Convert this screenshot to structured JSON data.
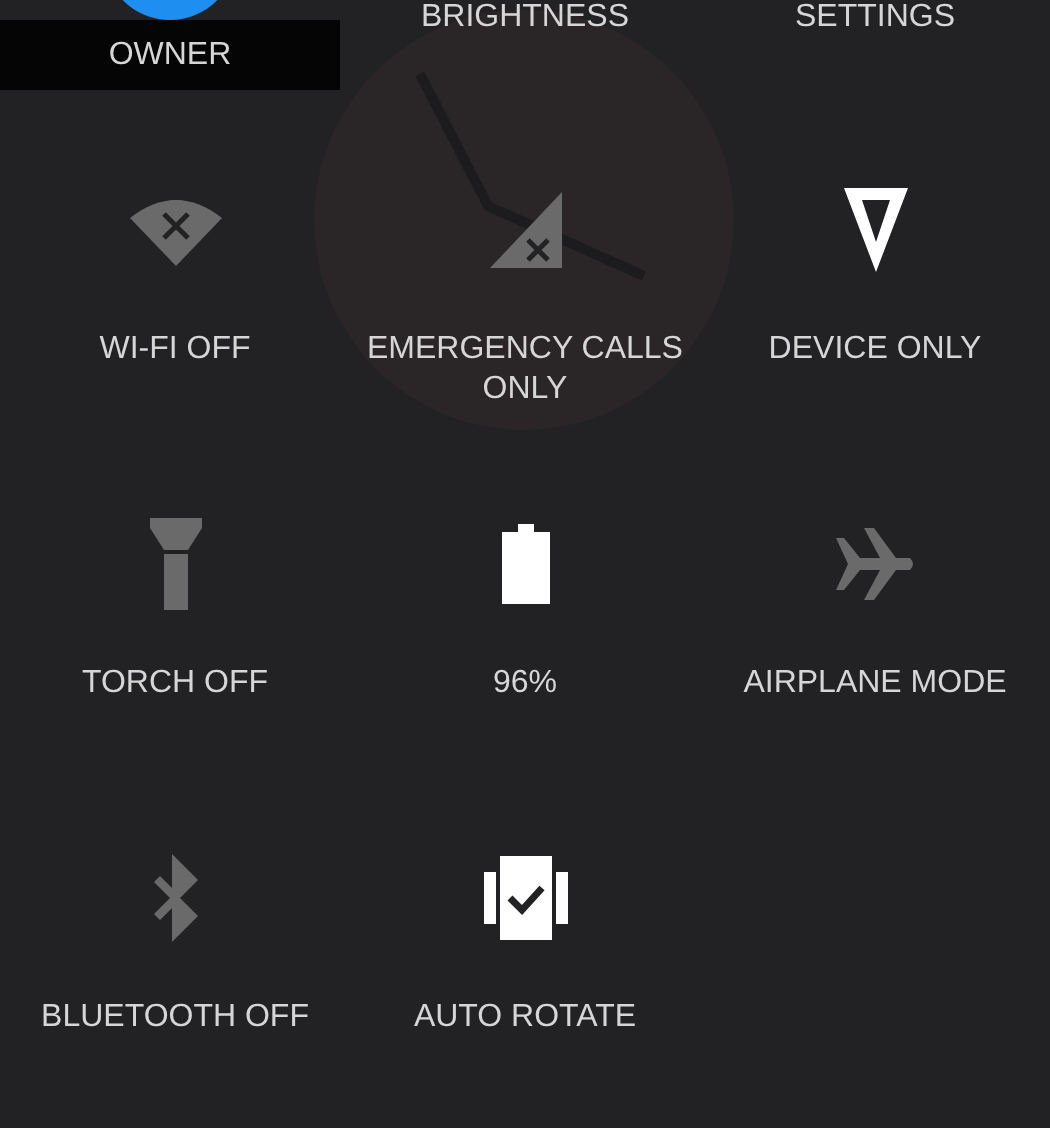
{
  "header": [
    {
      "kind": "owner",
      "label": "OWNER"
    },
    {
      "kind": "plain",
      "label": "BRIGHTNESS"
    },
    {
      "kind": "plain",
      "label": "SETTINGS"
    }
  ],
  "tiles": [
    {
      "kind": "wifi",
      "label": "WI-FI OFF",
      "on": false
    },
    {
      "kind": "signal",
      "label": "EMERGENCY CALLS ONLY",
      "on": false
    },
    {
      "kind": "location",
      "label": "DEVICE ONLY",
      "on": true
    },
    {
      "kind": "torch",
      "label": "TORCH OFF",
      "on": false
    },
    {
      "kind": "battery",
      "label": "96%",
      "on": true
    },
    {
      "kind": "airplane",
      "label": "AIRPLANE MODE",
      "on": false
    },
    {
      "kind": "bluetooth",
      "label": "BLUETOOTH OFF",
      "on": false
    },
    {
      "kind": "rotate",
      "label": "AUTO ROTATE",
      "on": true
    }
  ]
}
